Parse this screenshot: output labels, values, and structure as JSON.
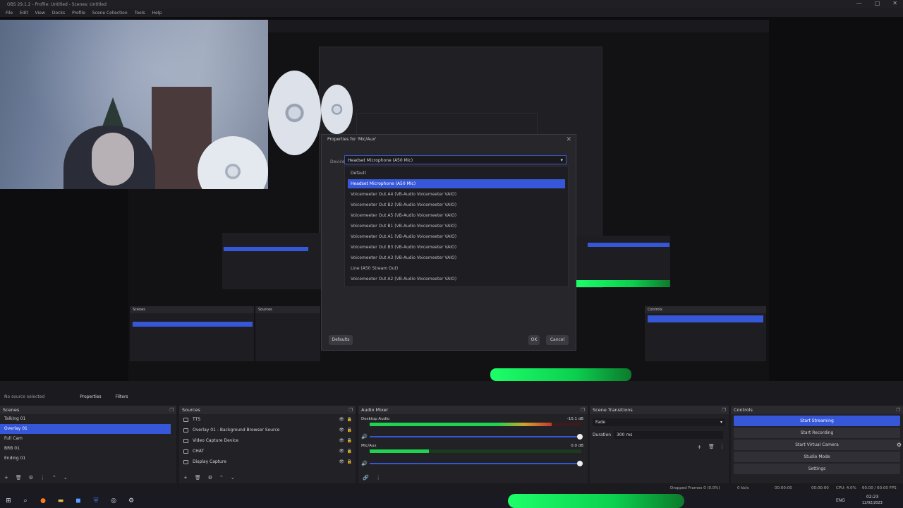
{
  "window": {
    "title": "OBS 29.1.2 - Profile: Untitled - Scenes: Untitled",
    "controls": [
      "—",
      "□",
      "✕"
    ]
  },
  "menu": [
    "File",
    "Edit",
    "View",
    "Docks",
    "Profile",
    "Scene Collection",
    "Tools",
    "Help"
  ],
  "dialog": {
    "title": "Properties for 'Mic/Aux'",
    "label": "Device",
    "selected": "Headset Microphone (A50 Mic)",
    "options": [
      "Default",
      "Headset Microphone (A50 Mic)",
      "Voicemeeter Out A4 (VB-Audio Voicemeeter VAIO)",
      "Voicemeeter Out B2 (VB-Audio Voicemeeter VAIO)",
      "Voicemeeter Out A5 (VB-Audio Voicemeeter VAIO)",
      "Voicemeeter Out B1 (VB-Audio Voicemeeter VAIO)",
      "Voicemeeter Out A1 (VB-Audio Voicemeeter VAIO)",
      "Voicemeeter Out B3 (VB-Audio Voicemeeter VAIO)",
      "Voicemeeter Out A3 (VB-Audio Voicemeeter VAIO)",
      "Line (A50 Stream Out)",
      "Voicemeeter Out A2 (VB-Audio Voicemeeter VAIO)"
    ],
    "defaults": "Defaults",
    "ok": "OK",
    "cancel": "Cancel"
  },
  "scene_bar": {
    "no_source": "No source selected",
    "properties": "Properties",
    "filters": "Filters"
  },
  "scenes": {
    "title": "Scenes",
    "items": [
      "Talking 01",
      "Overlay 01",
      "Full Cam",
      "BRB 01",
      "Ending 01"
    ],
    "selected_index": 1
  },
  "sources": {
    "title": "Sources",
    "items": [
      "TTS",
      "Overlay 01 - Background Browser Source",
      "Video Capture Device",
      "CHAT",
      "Display Capture"
    ]
  },
  "audio_mixer": {
    "title": "Audio Mixer",
    "tracks": [
      {
        "name": "Desktop Audio",
        "db": "-10.1 dB",
        "level": 0.86
      },
      {
        "name": "Mic/Aux",
        "db": "0.0 dB",
        "level": 0.28
      }
    ]
  },
  "transitions": {
    "title": "Scene Transitions",
    "type": "Fade",
    "duration_label": "Duration",
    "duration": "300 ms"
  },
  "controls": {
    "title": "Controls",
    "buttons": [
      "Start Streaming",
      "Start Recording",
      "Start Virtual Camera",
      "Studio Mode",
      "Settings"
    ]
  },
  "status": {
    "dropped": "Dropped Frames 0 (0.0%)",
    "kbps": "0 kb/s",
    "live": "00:00:00",
    "rec": "00:00:00",
    "cpu": "CPU: 4.0%",
    "fps": "60.00 / 60.00 FPS"
  },
  "taskbar": {
    "time": "02:23",
    "date": "12/02/2023",
    "lang": "ENG"
  },
  "colors": {
    "accent": "#3657d8",
    "bg": "#1b1b1f",
    "meter_green": "#1dd34f"
  }
}
